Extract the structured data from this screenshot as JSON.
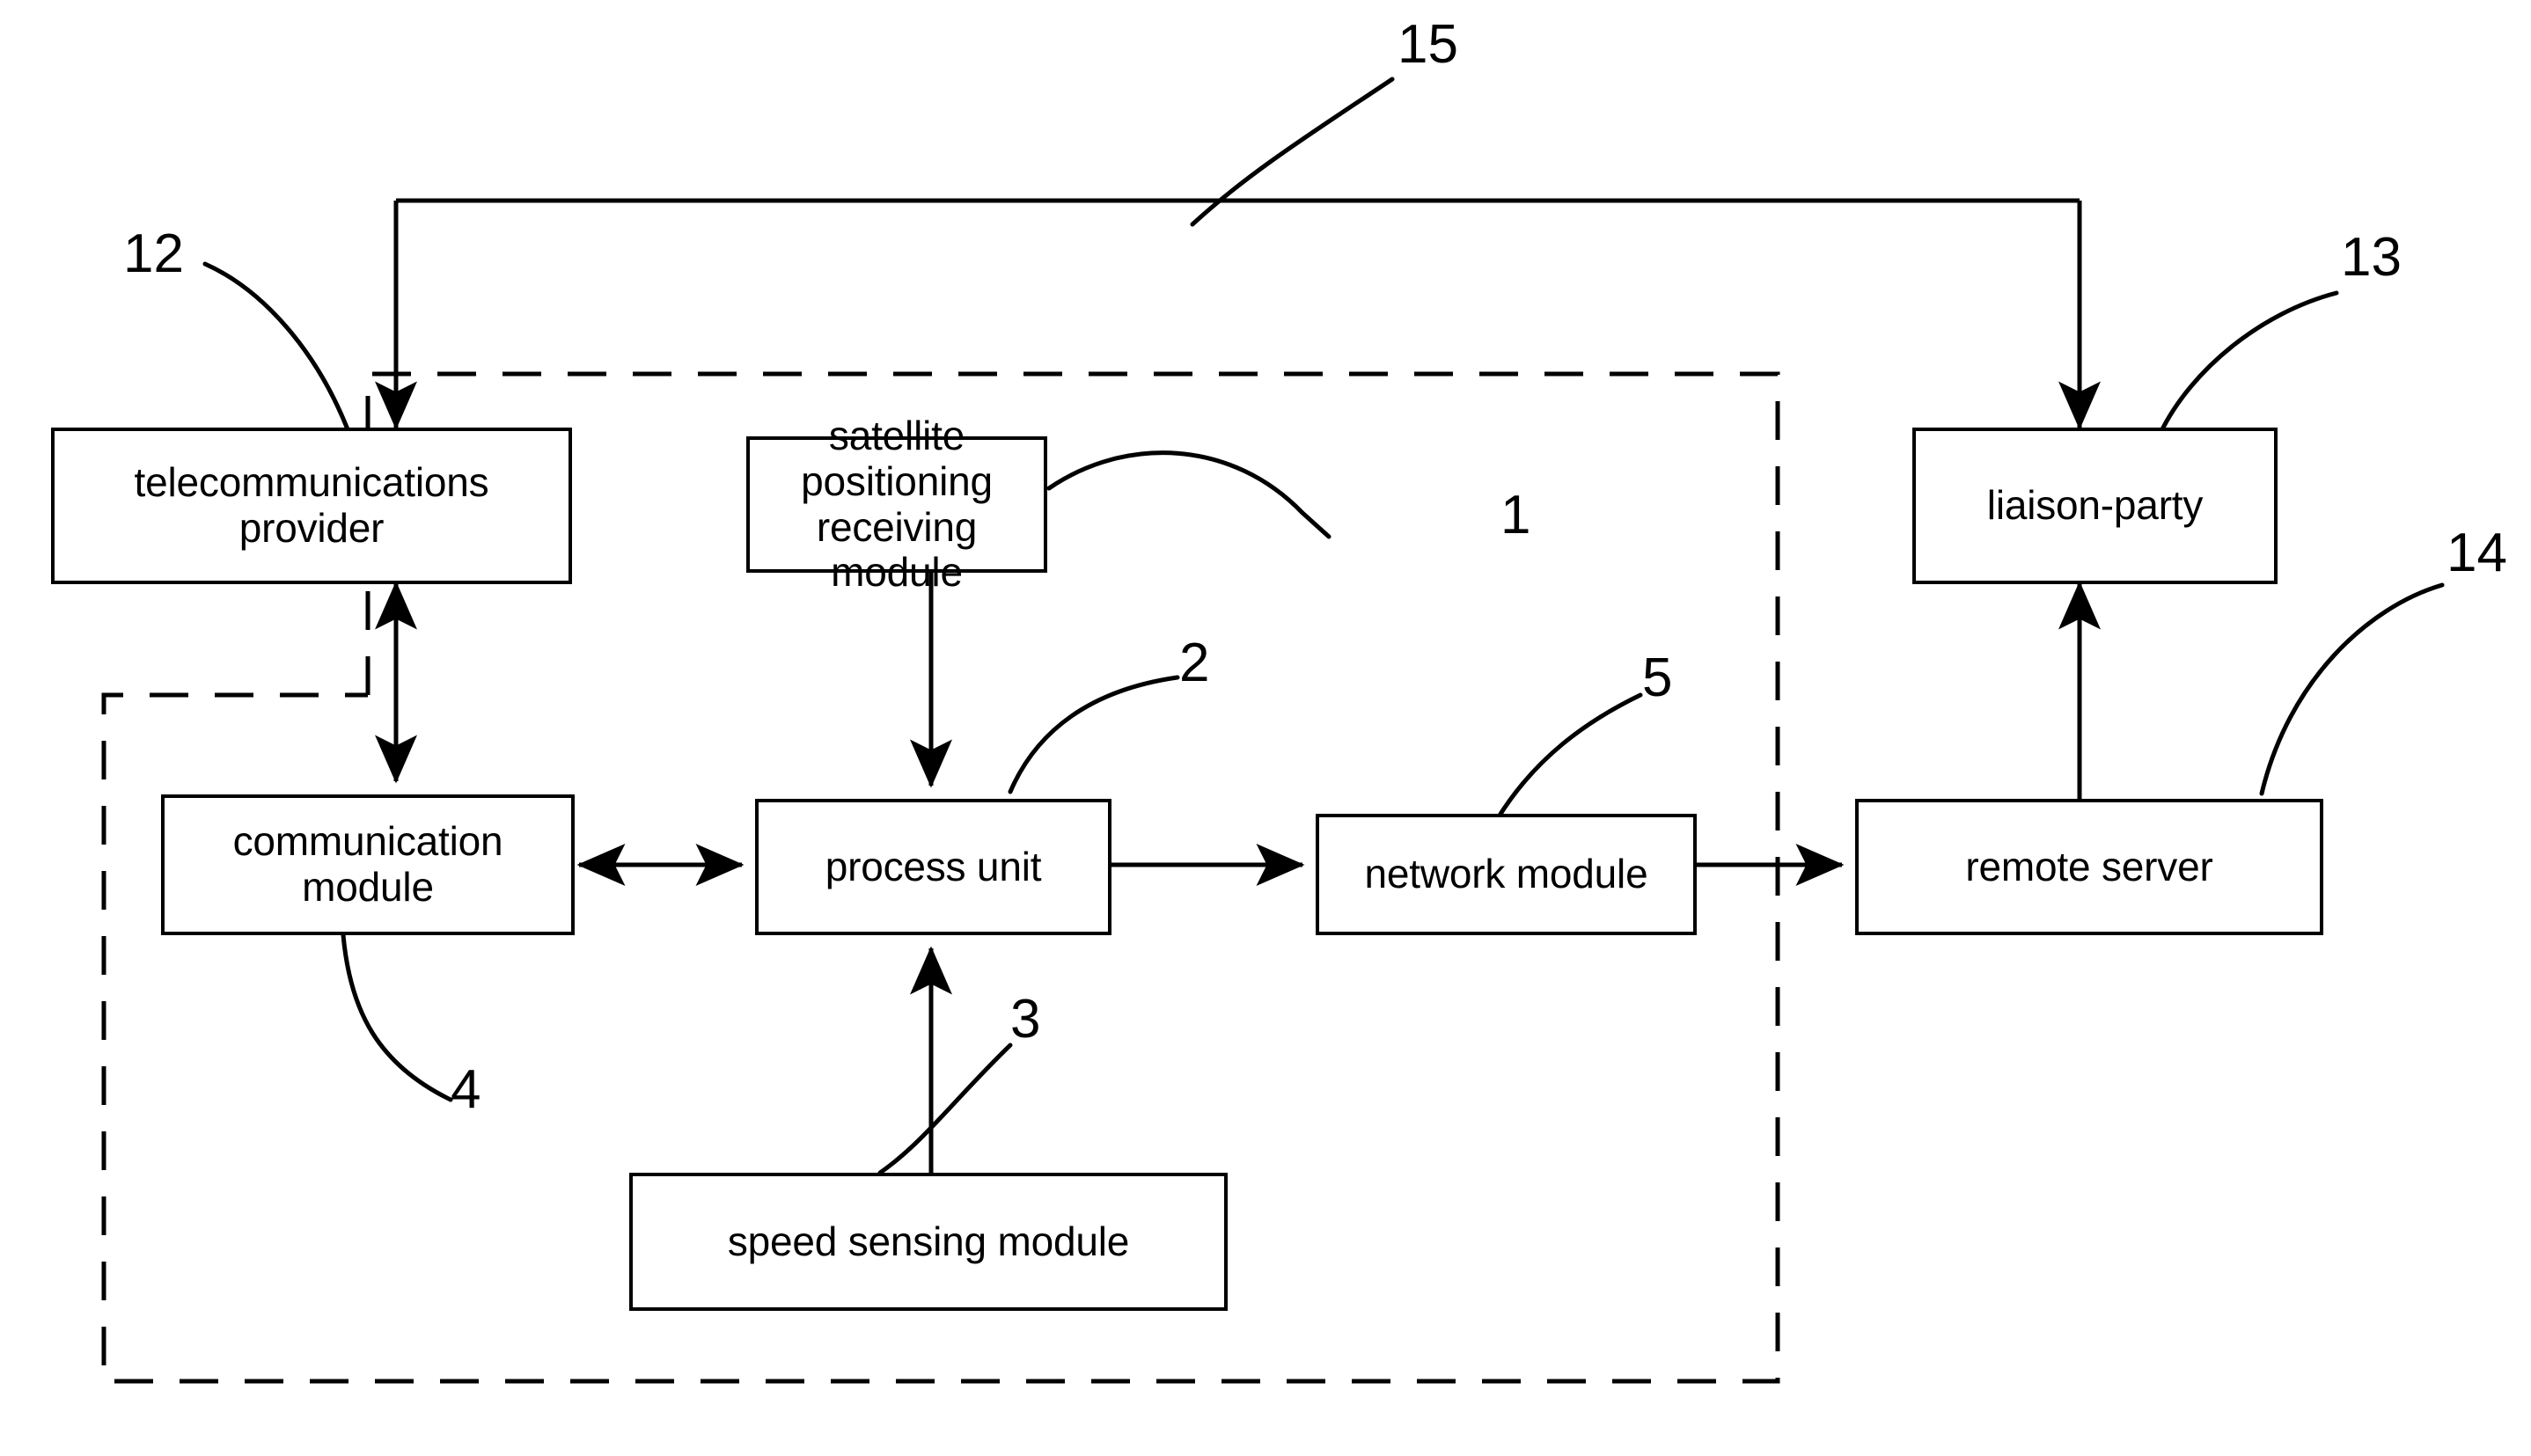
{
  "figure": {
    "type": "patent-block-diagram",
    "background_color": "#ffffff",
    "line_color": "#000000"
  },
  "nodes": [
    {
      "id": "telecommunications-provider",
      "label": "telecommunications\nprovider"
    },
    {
      "id": "satellite-positioning-receiving-module",
      "label": "satellite positioning\nreceiving module"
    },
    {
      "id": "liaison-party",
      "label": "liaison-party"
    },
    {
      "id": "communication-module",
      "label": "communication\nmodule"
    },
    {
      "id": "process-unit",
      "label": "process unit"
    },
    {
      "id": "network-module",
      "label": "network module"
    },
    {
      "id": "remote-server",
      "label": "remote server"
    },
    {
      "id": "speed-sensing-module",
      "label": "speed sensing module"
    }
  ],
  "reference_numerals": [
    {
      "id": "ref-1",
      "value": "1",
      "points_to": "satellite-positioning-receiving-module"
    },
    {
      "id": "ref-2",
      "value": "2",
      "points_to": "process-unit"
    },
    {
      "id": "ref-3",
      "value": "3",
      "points_to": "speed-sensing-module"
    },
    {
      "id": "ref-4",
      "value": "4",
      "points_to": "communication-module"
    },
    {
      "id": "ref-5",
      "value": "5",
      "points_to": "network-module"
    },
    {
      "id": "ref-12",
      "value": "12",
      "points_to": "telecommunications-provider"
    },
    {
      "id": "ref-13",
      "value": "13",
      "points_to": "liaison-party"
    },
    {
      "id": "ref-14",
      "value": "14",
      "points_to": "remote-server"
    },
    {
      "id": "ref-15",
      "value": "15",
      "points_to": "dashed-enclosure"
    }
  ],
  "connections": [
    {
      "from": "telecommunications-provider",
      "to": "communication-module",
      "arrow": "double"
    },
    {
      "from": "satellite-positioning-receiving-module",
      "to": "process-unit",
      "arrow": "single"
    },
    {
      "from": "communication-module",
      "to": "process-unit",
      "arrow": "double"
    },
    {
      "from": "process-unit",
      "to": "network-module",
      "arrow": "single"
    },
    {
      "from": "network-module",
      "to": "remote-server",
      "arrow": "single"
    },
    {
      "from": "speed-sensing-module",
      "to": "process-unit",
      "arrow": "single"
    },
    {
      "from": "remote-server",
      "to": "liaison-party",
      "arrow": "single"
    },
    {
      "from": "bus-line-15",
      "to": "telecommunications-provider",
      "arrow": "single"
    },
    {
      "from": "bus-line-15",
      "to": "liaison-party",
      "arrow": "single"
    }
  ]
}
